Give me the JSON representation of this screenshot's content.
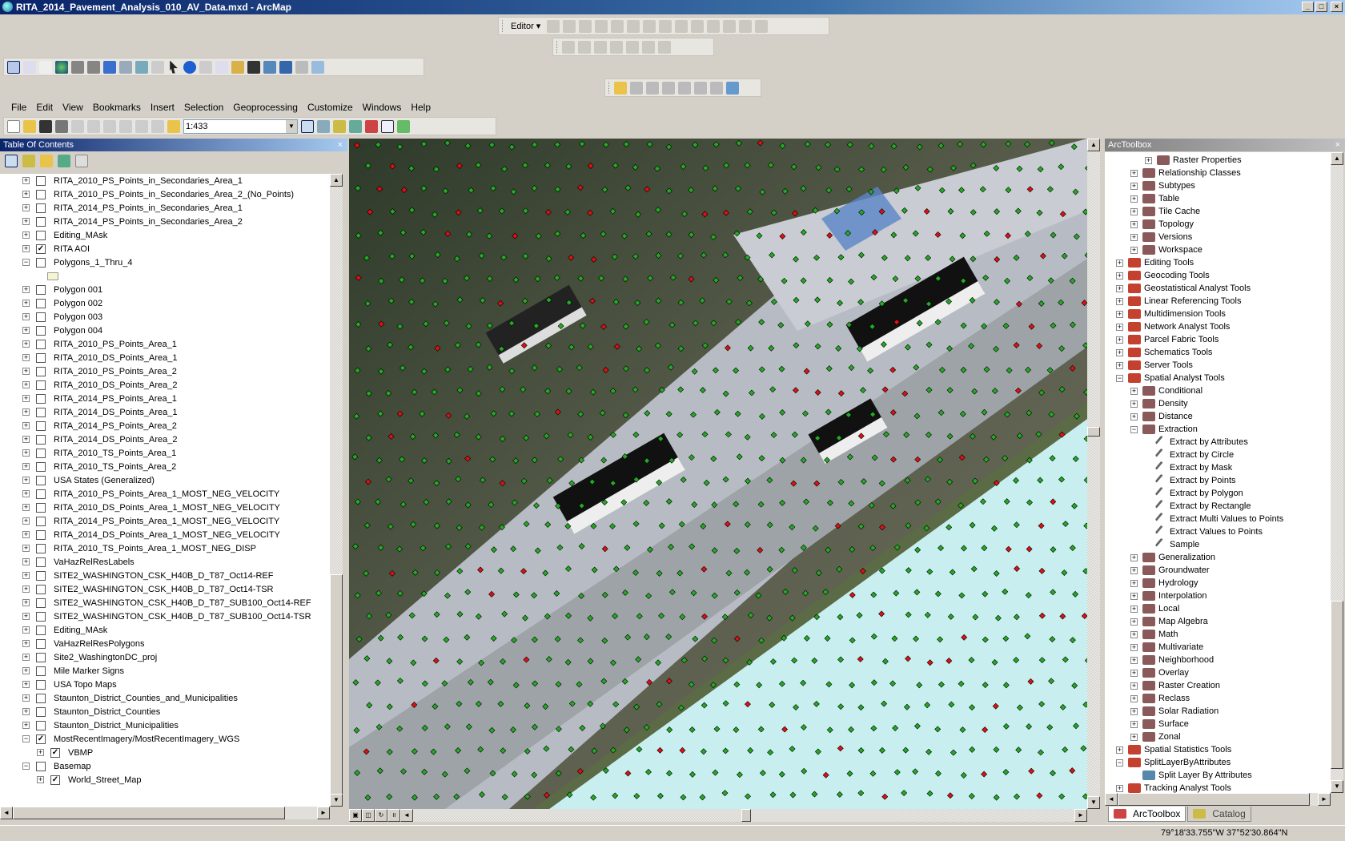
{
  "window": {
    "title": "RITA_2014_Pavement_Analysis_010_AV_Data.mxd - ArcMap",
    "min": "_",
    "max": "□",
    "close": "×"
  },
  "editor_toolbar": {
    "label": "Editor ▾"
  },
  "menu": [
    "File",
    "Edit",
    "View",
    "Bookmarks",
    "Insert",
    "Selection",
    "Geoprocessing",
    "Customize",
    "Windows",
    "Help"
  ],
  "standard_toolbar": {
    "scale_value": "1:433"
  },
  "toc": {
    "title": "Table Of Contents",
    "items": [
      {
        "label": "RITA_2010_PS_Points_in_Secondaries_Area_1",
        "level": 0,
        "expand": "+",
        "checked": false
      },
      {
        "label": "RITA_2010_PS_Points_in_Secondaries_Area_2_(No_Points)",
        "level": 0,
        "expand": "+",
        "checked": false
      },
      {
        "label": "RITA_2014_PS_Points_in_Secondaries_Area_1",
        "level": 0,
        "expand": "+",
        "checked": false
      },
      {
        "label": "RITA_2014_PS_Points_in_Secondaries_Area_2",
        "level": 0,
        "expand": "+",
        "checked": false
      },
      {
        "label": "Editing_MAsk",
        "level": 0,
        "expand": "+",
        "checked": false
      },
      {
        "label": "RITA AOI",
        "level": 0,
        "expand": "+",
        "checked": true
      },
      {
        "label": "Polygons_1_Thru_4",
        "level": 0,
        "expand": "-",
        "checked": false
      },
      {
        "label": "",
        "level": 0,
        "swatch": true
      },
      {
        "label": "Polygon 001",
        "level": 0,
        "expand": "+",
        "checked": false
      },
      {
        "label": "Polygon 002",
        "level": 0,
        "expand": "+",
        "checked": false
      },
      {
        "label": "Polygon 003",
        "level": 0,
        "expand": "+",
        "checked": false
      },
      {
        "label": "Polygon 004",
        "level": 0,
        "expand": "+",
        "checked": false
      },
      {
        "label": "RITA_2010_PS_Points_Area_1",
        "level": 0,
        "expand": "+",
        "checked": false
      },
      {
        "label": "RITA_2010_DS_Points_Area_1",
        "level": 0,
        "expand": "+",
        "checked": false
      },
      {
        "label": "RITA_2010_PS_Points_Area_2",
        "level": 0,
        "expand": "+",
        "checked": false
      },
      {
        "label": "RITA_2010_DS_Points_Area_2",
        "level": 0,
        "expand": "+",
        "checked": false
      },
      {
        "label": "RITA_2014_PS_Points_Area_1",
        "level": 0,
        "expand": "+",
        "checked": false
      },
      {
        "label": "RITA_2014_DS_Points_Area_1",
        "level": 0,
        "expand": "+",
        "checked": false
      },
      {
        "label": "RITA_2014_PS_Points_Area_2",
        "level": 0,
        "expand": "+",
        "checked": false
      },
      {
        "label": "RITA_2014_DS_Points_Area_2",
        "level": 0,
        "expand": "+",
        "checked": false
      },
      {
        "label": "RITA_2010_TS_Points_Area_1",
        "level": 0,
        "expand": "+",
        "checked": false
      },
      {
        "label": "RITA_2010_TS_Points_Area_2",
        "level": 0,
        "expand": "+",
        "checked": false
      },
      {
        "label": "USA States (Generalized)",
        "level": 0,
        "expand": "+",
        "checked": false
      },
      {
        "label": "RITA_2010_PS_Points_Area_1_MOST_NEG_VELOCITY",
        "level": 0,
        "expand": "+",
        "checked": false
      },
      {
        "label": "RITA_2010_DS_Points_Area_1_MOST_NEG_VELOCITY",
        "level": 0,
        "expand": "+",
        "checked": false
      },
      {
        "label": "RITA_2014_PS_Points_Area_1_MOST_NEG_VELOCITY",
        "level": 0,
        "expand": "+",
        "checked": false
      },
      {
        "label": "RITA_2014_DS_Points_Area_1_MOST_NEG_VELOCITY",
        "level": 0,
        "expand": "+",
        "checked": false
      },
      {
        "label": "RITA_2010_TS_Points_Area_1_MOST_NEG_DISP",
        "level": 0,
        "expand": "+",
        "checked": false
      },
      {
        "label": "VaHazRelResLabels",
        "level": 0,
        "expand": "+",
        "checked": false
      },
      {
        "label": "SITE2_WASHINGTON_CSK_H40B_D_T87_Oct14-REF",
        "level": 0,
        "expand": "+",
        "checked": false
      },
      {
        "label": "SITE2_WASHINGTON_CSK_H40B_D_T87_Oct14-TSR",
        "level": 0,
        "expand": "+",
        "checked": false
      },
      {
        "label": "SITE2_WASHINGTON_CSK_H40B_D_T87_SUB100_Oct14-REF",
        "level": 0,
        "expand": "+",
        "checked": false
      },
      {
        "label": "SITE2_WASHINGTON_CSK_H40B_D_T87_SUB100_Oct14-TSR",
        "level": 0,
        "expand": "+",
        "checked": false
      },
      {
        "label": "Editing_MAsk",
        "level": 0,
        "expand": "+",
        "checked": false
      },
      {
        "label": "VaHazRelResPolygons",
        "level": 0,
        "expand": "+",
        "checked": false
      },
      {
        "label": "Site2_WashingtonDC_proj",
        "level": 0,
        "expand": "+",
        "checked": false
      },
      {
        "label": "Mile Marker Signs",
        "level": 0,
        "expand": "+",
        "checked": false
      },
      {
        "label": "USA Topo Maps",
        "level": 0,
        "expand": "+",
        "checked": false
      },
      {
        "label": "Staunton_District_Counties_and_Municipalities",
        "level": 0,
        "expand": "+",
        "checked": false
      },
      {
        "label": "Staunton_District_Counties",
        "level": 0,
        "expand": "+",
        "checked": false
      },
      {
        "label": "Staunton_District_Municipalities",
        "level": 0,
        "expand": "+",
        "checked": false
      },
      {
        "label": "MostRecentImagery/MostRecentImagery_WGS",
        "level": 0,
        "expand": "-",
        "checked": true
      },
      {
        "label": "VBMP",
        "level": 1,
        "expand": "+",
        "checked": true
      },
      {
        "label": "Basemap",
        "level": 0,
        "expand": "-",
        "checked": false
      },
      {
        "label": "World_Street_Map",
        "level": 1,
        "expand": "+",
        "checked": true
      }
    ]
  },
  "arctoolbox": {
    "title": "ArcToolbox",
    "items": [
      {
        "label": "Raster Properties",
        "level": 2,
        "expand": "+",
        "kind": "toolset"
      },
      {
        "label": "Relationship Classes",
        "level": 1,
        "expand": "+",
        "kind": "toolset"
      },
      {
        "label": "Subtypes",
        "level": 1,
        "expand": "+",
        "kind": "toolset"
      },
      {
        "label": "Table",
        "level": 1,
        "expand": "+",
        "kind": "toolset"
      },
      {
        "label": "Tile Cache",
        "level": 1,
        "expand": "+",
        "kind": "toolset"
      },
      {
        "label": "Topology",
        "level": 1,
        "expand": "+",
        "kind": "toolset"
      },
      {
        "label": "Versions",
        "level": 1,
        "expand": "+",
        "kind": "toolset"
      },
      {
        "label": "Workspace",
        "level": 1,
        "expand": "+",
        "kind": "toolset"
      },
      {
        "label": "Editing Tools",
        "level": 0,
        "expand": "+",
        "kind": "toolbox"
      },
      {
        "label": "Geocoding Tools",
        "level": 0,
        "expand": "+",
        "kind": "toolbox"
      },
      {
        "label": "Geostatistical Analyst Tools",
        "level": 0,
        "expand": "+",
        "kind": "toolbox"
      },
      {
        "label": "Linear Referencing Tools",
        "level": 0,
        "expand": "+",
        "kind": "toolbox"
      },
      {
        "label": "Multidimension Tools",
        "level": 0,
        "expand": "+",
        "kind": "toolbox"
      },
      {
        "label": "Network Analyst Tools",
        "level": 0,
        "expand": "+",
        "kind": "toolbox"
      },
      {
        "label": "Parcel Fabric Tools",
        "level": 0,
        "expand": "+",
        "kind": "toolbox"
      },
      {
        "label": "Schematics Tools",
        "level": 0,
        "expand": "+",
        "kind": "toolbox"
      },
      {
        "label": "Server Tools",
        "level": 0,
        "expand": "+",
        "kind": "toolbox"
      },
      {
        "label": "Spatial Analyst Tools",
        "level": 0,
        "expand": "-",
        "kind": "toolbox"
      },
      {
        "label": "Conditional",
        "level": 1,
        "expand": "+",
        "kind": "toolset"
      },
      {
        "label": "Density",
        "level": 1,
        "expand": "+",
        "kind": "toolset"
      },
      {
        "label": "Distance",
        "level": 1,
        "expand": "+",
        "kind": "toolset"
      },
      {
        "label": "Extraction",
        "level": 1,
        "expand": "-",
        "kind": "toolset"
      },
      {
        "label": "Extract by Attributes",
        "level": 2,
        "kind": "tool"
      },
      {
        "label": "Extract by Circle",
        "level": 2,
        "kind": "tool"
      },
      {
        "label": "Extract by Mask",
        "level": 2,
        "kind": "tool"
      },
      {
        "label": "Extract by Points",
        "level": 2,
        "kind": "tool"
      },
      {
        "label": "Extract by Polygon",
        "level": 2,
        "kind": "tool"
      },
      {
        "label": "Extract by Rectangle",
        "level": 2,
        "kind": "tool"
      },
      {
        "label": "Extract Multi Values to Points",
        "level": 2,
        "kind": "tool"
      },
      {
        "label": "Extract Values to Points",
        "level": 2,
        "kind": "tool"
      },
      {
        "label": "Sample",
        "level": 2,
        "kind": "tool"
      },
      {
        "label": "Generalization",
        "level": 1,
        "expand": "+",
        "kind": "toolset"
      },
      {
        "label": "Groundwater",
        "level": 1,
        "expand": "+",
        "kind": "toolset"
      },
      {
        "label": "Hydrology",
        "level": 1,
        "expand": "+",
        "kind": "toolset"
      },
      {
        "label": "Interpolation",
        "level": 1,
        "expand": "+",
        "kind": "toolset"
      },
      {
        "label": "Local",
        "level": 1,
        "expand": "+",
        "kind": "toolset"
      },
      {
        "label": "Map Algebra",
        "level": 1,
        "expand": "+",
        "kind": "toolset"
      },
      {
        "label": "Math",
        "level": 1,
        "expand": "+",
        "kind": "toolset"
      },
      {
        "label": "Multivariate",
        "level": 1,
        "expand": "+",
        "kind": "toolset"
      },
      {
        "label": "Neighborhood",
        "level": 1,
        "expand": "+",
        "kind": "toolset"
      },
      {
        "label": "Overlay",
        "level": 1,
        "expand": "+",
        "kind": "toolset"
      },
      {
        "label": "Raster Creation",
        "level": 1,
        "expand": "+",
        "kind": "toolset"
      },
      {
        "label": "Reclass",
        "level": 1,
        "expand": "+",
        "kind": "toolset"
      },
      {
        "label": "Solar Radiation",
        "level": 1,
        "expand": "+",
        "kind": "toolset"
      },
      {
        "label": "Surface",
        "level": 1,
        "expand": "+",
        "kind": "toolset"
      },
      {
        "label": "Zonal",
        "level": 1,
        "expand": "+",
        "kind": "toolset"
      },
      {
        "label": "Spatial Statistics Tools",
        "level": 0,
        "expand": "+",
        "kind": "toolbox"
      },
      {
        "label": "SplitLayerByAttributes",
        "level": 0,
        "expand": "-",
        "kind": "toolbox"
      },
      {
        "label": "Split Layer By Attributes",
        "level": 1,
        "kind": "script"
      },
      {
        "label": "Tracking Analyst Tools",
        "level": 0,
        "expand": "+",
        "kind": "toolbox"
      }
    ],
    "tabs": [
      "ArcToolbox",
      "Catalog"
    ]
  },
  "status": {
    "coordinates": "79°18'33.755\"W  37°52'30.864\"N"
  },
  "colors": {
    "points_green": "#22aa22",
    "points_red": "#dd1111",
    "polygon_fill": "#c8eef0",
    "title_bar": "#0a246a"
  }
}
